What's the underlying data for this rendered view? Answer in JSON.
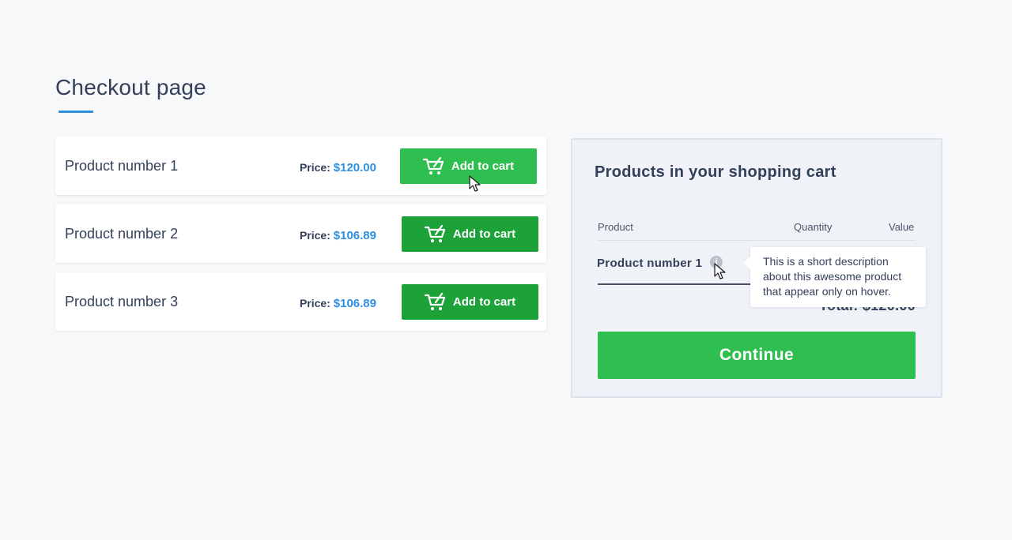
{
  "page": {
    "title": "Checkout page"
  },
  "products": [
    {
      "name": "Product number 1",
      "price_label": "Price:",
      "price": "$120.00",
      "button_label": "Add to cart"
    },
    {
      "name": "Product number 2",
      "price_label": "Price:",
      "price": "$106.89",
      "button_label": "Add to cart"
    },
    {
      "name": "Product number 3",
      "price_label": "Price:",
      "price": "$106.89",
      "button_label": "Add to cart"
    }
  ],
  "cart": {
    "title": "Products in your shopping cart",
    "columns": {
      "product": "Product",
      "quantity": "Quantity",
      "value": "Value"
    },
    "items": [
      {
        "name": "Product number 1"
      }
    ],
    "info_icon_glyph": "i",
    "tooltip": "This is a short description about this awesome product that appear only on hover.",
    "total": "Total: $120.00",
    "continue_label": "Continue"
  },
  "colors": {
    "accent_blue": "#2f8fe0",
    "button_green": "#1da23a",
    "button_green_hover": "#2fbe50",
    "text_dark": "#34405a"
  },
  "icons": {
    "add_to_cart": "cart-icon",
    "info": "info-icon",
    "pointer": "mouse-cursor-icon"
  }
}
